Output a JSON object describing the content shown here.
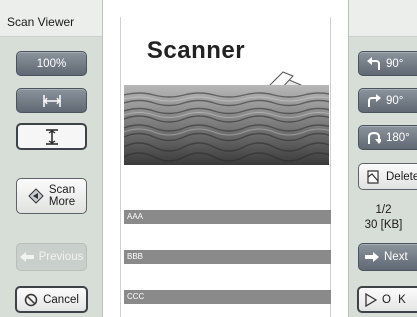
{
  "window": {
    "title": "Scan Viewer"
  },
  "left_panel": {
    "zoom_label": "100%",
    "scan_more_line1": "Scan",
    "scan_more_line2": "More",
    "previous_label": "Previous",
    "cancel_label": "Cancel"
  },
  "right_panel": {
    "rotate_left_label": "90°",
    "rotate_right_label": "90°",
    "rotate_180_label": "180°",
    "delete_label": "Delete",
    "page_indicator": "1/2",
    "file_size": "30 [KB]",
    "next_label": "Next",
    "ok_label": "O K"
  },
  "document": {
    "title": "Scanner",
    "rows": [
      {
        "label": "AAA"
      },
      {
        "label": "BBB"
      },
      {
        "label": "CCC"
      }
    ]
  },
  "colors": {
    "panel_bg": "#d7ddd7",
    "dark_button": "#6b747e",
    "row_bar": "#8a8a8a"
  },
  "icons": [
    "fit-width-icon",
    "fit-height-icon",
    "scan-more-icon",
    "arrow-left-icon",
    "cancel-icon",
    "rotate-left-icon",
    "rotate-right-icon",
    "rotate-180-icon",
    "delete-icon",
    "arrow-right-icon",
    "ok-play-icon",
    "scanner-illustration"
  ]
}
